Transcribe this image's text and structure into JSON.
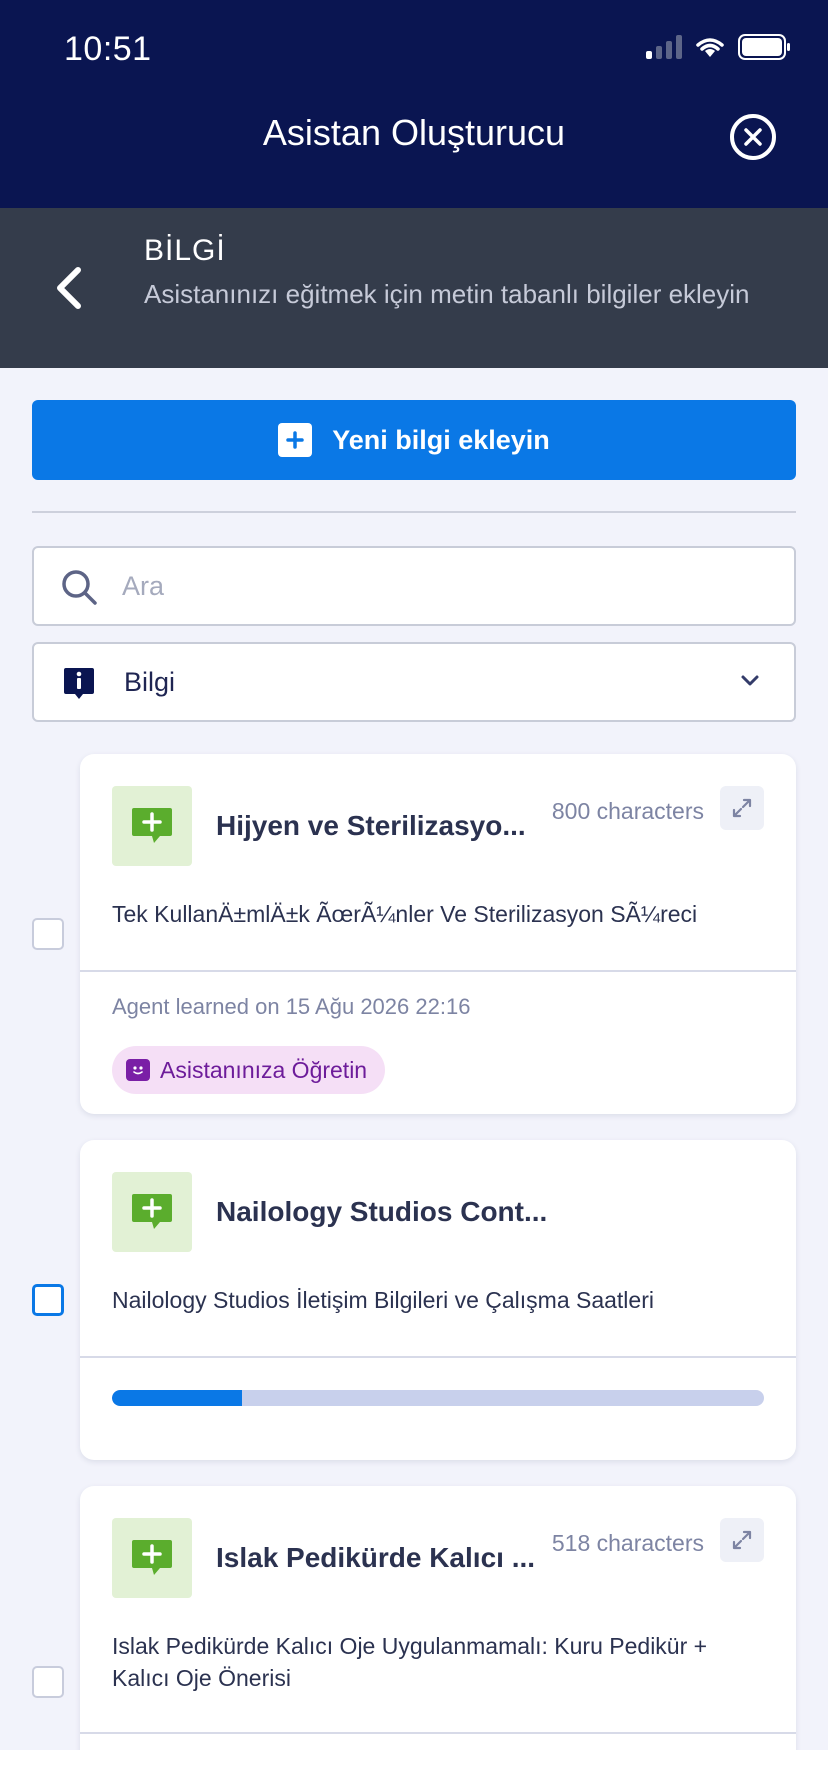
{
  "status_bar": {
    "time": "10:51"
  },
  "header": {
    "title": "Asistan Oluşturucu"
  },
  "section": {
    "title": "BİLGİ",
    "subtitle": "Asistanınızı eğitmek için metin tabanlı bilgiler ekleyin"
  },
  "add_button": {
    "label": "Yeni bilgi ekleyin"
  },
  "search": {
    "placeholder": "Ara",
    "value": ""
  },
  "filter": {
    "selected": "Bilgi"
  },
  "colors": {
    "nav_bg": "#0a1551",
    "section_bg": "#343c4b",
    "accent": "#0a78e6",
    "thumb_bg": "#e2f1d5",
    "thumb_icon": "#5bad2d",
    "teach_bg": "#f5dff6",
    "teach_text": "#6d1c9a"
  },
  "items": [
    {
      "title": "Hijyen ve Sterilizasyo...",
      "characters": "800 characters",
      "description": "Tek KullanÄ±mlÄ±k ÃœrÃ¼nler Ve Sterilizasyon SÃ¼reci",
      "learned": "Agent learned on 15 Ağu 2026 22:16",
      "teach_label": "Asistanınıza Öğretin",
      "icon": "chat-plus-icon"
    },
    {
      "title": "Nailology Studios Cont...",
      "description": "Nailology Studios İletişim Bilgileri ve Çalışma Saatleri",
      "progress": 0.2,
      "icon": "chat-plus-icon"
    },
    {
      "title": "Islak Pedikürde Kalıcı ...",
      "characters": "518 characters",
      "description": "Islak Pedikürde Kalıcı Oje Uygulanmamalı: Kuru Pedikür + Kalıcı Oje Önerisi",
      "icon": "chat-plus-icon"
    }
  ]
}
